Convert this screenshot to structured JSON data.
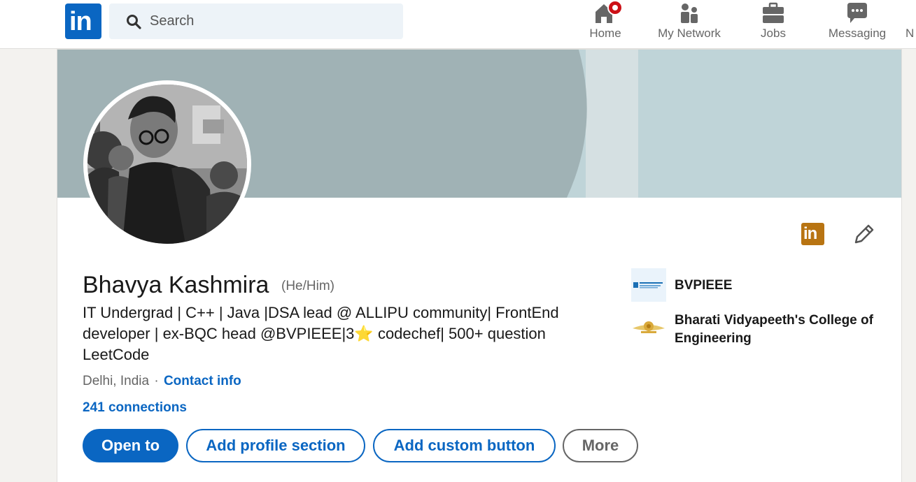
{
  "nav": {
    "logo_text": "in",
    "search_placeholder": "Search",
    "items": [
      {
        "label": "Home",
        "icon": "home-icon"
      },
      {
        "label": "My Network",
        "icon": "network-icon"
      },
      {
        "label": "Jobs",
        "icon": "briefcase-icon"
      },
      {
        "label": "Messaging",
        "icon": "chat-icon"
      },
      {
        "label": "N",
        "icon": "notifications-icon"
      }
    ]
  },
  "profile": {
    "name": "Bhavya Kashmira",
    "pronouns": "(He/Him)",
    "headline_pre": "IT Undergrad | C++ | Java |DSA lead @ ALLIPU community| FrontEnd developer | ex-BQC head @BVPIEEE|3",
    "headline_emoji": "⭐",
    "headline_post": "codechef| 500+ question LeetCode",
    "location": "Delhi, India",
    "separator": "·",
    "contact_info": "Contact info",
    "connections": "241 connections",
    "badge_text": "in"
  },
  "actions": {
    "open_to": "Open to",
    "add_profile_section": "Add profile section",
    "add_custom_button": "Add custom button",
    "more": "More"
  },
  "orgs": [
    {
      "name": "BVPIEEE"
    },
    {
      "name": "Bharati Vidyapeeth's College of Engineering"
    }
  ],
  "colors": {
    "brand_blue": "#0a66c2",
    "banner_main": "#a0b2b5",
    "banner_light": "#d5e0e2",
    "banner_right": "#bfd4d8",
    "notification_red": "#cc1016",
    "premium_gold": "#b87412"
  }
}
